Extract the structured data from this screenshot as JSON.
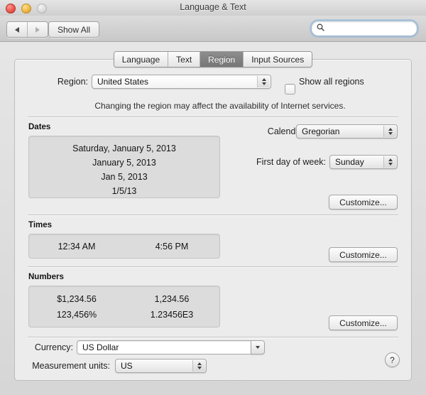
{
  "window": {
    "title": "Language & Text",
    "traffic_lights": [
      "close-button",
      "minimize-button",
      "zoom-button"
    ]
  },
  "toolbar": {
    "back_label": "◀",
    "forward_label": "▶",
    "show_all_label": "Show All",
    "search": {
      "value": "",
      "placeholder": ""
    }
  },
  "tabs": [
    {
      "label": "Language",
      "selected": false
    },
    {
      "label": "Text",
      "selected": false
    },
    {
      "label": "Region",
      "selected": true
    },
    {
      "label": "Input Sources",
      "selected": false
    }
  ],
  "region_row": {
    "label": "Region:",
    "value": "United States",
    "show_all_regions_label": "Show all regions",
    "show_all_regions_checked": false,
    "note": "Changing the region may affect the availability of Internet services."
  },
  "dates": {
    "section_label": "Dates",
    "previews": [
      "Saturday, January 5, 2013",
      "January 5, 2013",
      "Jan 5, 2013",
      "1/5/13"
    ],
    "calendar_label": "Calendar:",
    "calendar_value": "Gregorian",
    "first_day_label": "First day of week:",
    "first_day_value": "Sunday",
    "customize_label": "Customize..."
  },
  "times": {
    "section_label": "Times",
    "previews": [
      "12:34 AM",
      "4:56 PM"
    ],
    "customize_label": "Customize..."
  },
  "numbers": {
    "section_label": "Numbers",
    "previews": [
      "$1,234.56",
      "1,234.56",
      "123,456%",
      "1.23456E3"
    ],
    "customize_label": "Customize..."
  },
  "currency": {
    "label": "Currency:",
    "value": "US Dollar"
  },
  "measurement": {
    "label": "Measurement units:",
    "value": "US"
  },
  "help": {
    "label": "?"
  }
}
